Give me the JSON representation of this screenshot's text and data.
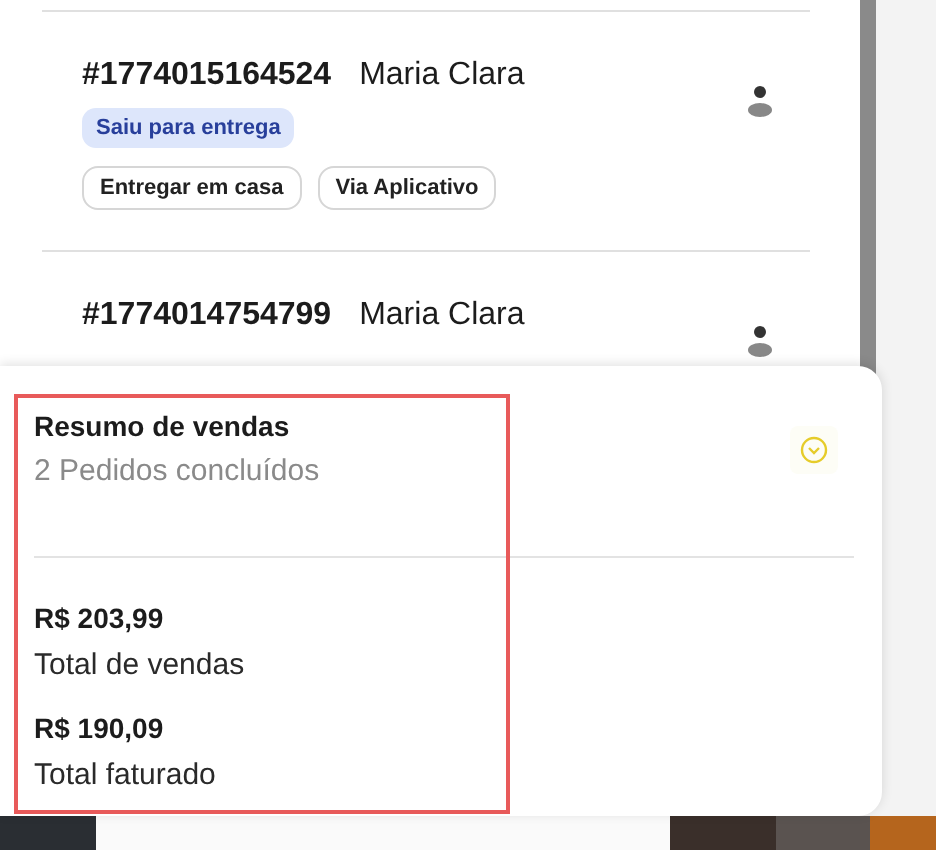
{
  "orders": [
    {
      "number": "#1774015164524",
      "customer": "Maria Clara",
      "status": "Saiu para entrega",
      "tags": [
        "Entregar em casa",
        "Via Aplicativo"
      ]
    },
    {
      "number": "#1774014754799",
      "customer": "Maria Clara"
    }
  ],
  "summary": {
    "title": "Resumo de vendas",
    "subtitle": "2 Pedidos concluídos",
    "expanded": false,
    "highlighted": true,
    "totals": [
      {
        "value": "R$ 203,99",
        "label": "Total de vendas"
      },
      {
        "value": "R$ 190,09",
        "label": "Total faturado"
      }
    ]
  }
}
